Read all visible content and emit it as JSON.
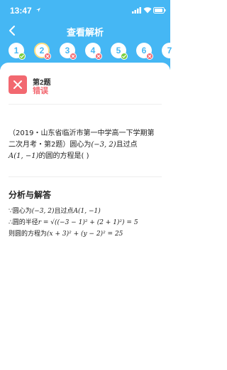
{
  "status_bar": {
    "time": "13:47"
  },
  "nav": {
    "title": "查看解析"
  },
  "questions": [
    {
      "num": "1",
      "result": "correct",
      "selected": false
    },
    {
      "num": "2",
      "result": "wrong",
      "selected": true
    },
    {
      "num": "3",
      "result": "wrong",
      "selected": false
    },
    {
      "num": "4",
      "result": "wrong",
      "selected": false
    },
    {
      "num": "5",
      "result": "correct",
      "selected": false
    },
    {
      "num": "6",
      "result": "wrong",
      "selected": false
    },
    {
      "num": "7",
      "result": "",
      "selected": false
    }
  ],
  "result": {
    "question_label": "第2题",
    "status": "错误"
  },
  "question": {
    "line1": "（2019・山东省临沂市第一中学高一下学期第",
    "line2_text": "二次月考・第2题）圆心为",
    "line2_math": "(−3, 2)",
    "line2_tail": "且过点",
    "line3_math": "A(1, −1)",
    "line3_text": "的圆的方程是(  )"
  },
  "analysis": {
    "title": "分析与解答",
    "line1_prefix": "∵圆心为",
    "line1_math1": "(−3, 2)",
    "line1_mid": "且过点",
    "line1_math2": "A(1, −1)",
    "line2_prefix": "∴圆的半径",
    "line2_math": "r = √((−3 − 1)² + (2 + 1)²) = 5",
    "line3_prefix": "则圆的方程为",
    "line3_math": "(x + 3)² + (y − 2)² = 25"
  },
  "colors": {
    "header": "#45b7f4",
    "correct": "#7ccf42",
    "wrong": "#f26870"
  }
}
